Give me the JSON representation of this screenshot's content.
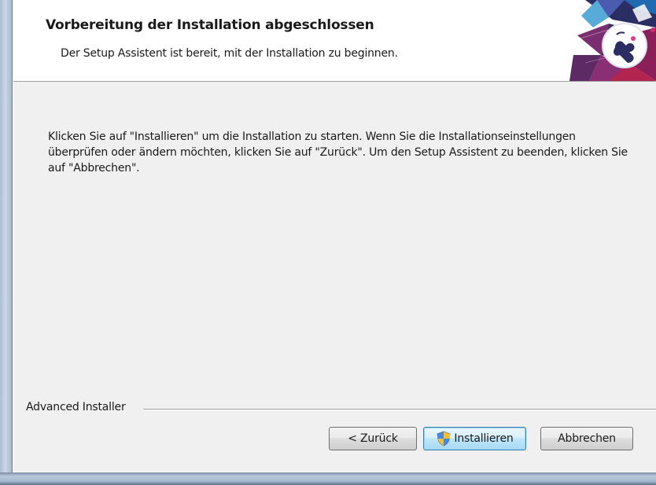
{
  "header": {
    "title": "Vorbereitung der Installation abgeschlossen",
    "subtitle": "Der Setup Assistent ist bereit, mit der Installation zu beginnen."
  },
  "body": {
    "text": "Klicken Sie auf \"Installieren\" um die Installation zu starten. Wenn Sie die Installationseinstellungen überprüfen oder ändern möchten, klicken Sie auf \"Zurück\". Um den Setup Assistent zu beenden, klicken Sie auf \"Abbrechen\"."
  },
  "footer": {
    "brand": "Advanced Installer",
    "buttons": {
      "back": "< Zurück",
      "install": "Installieren",
      "cancel": "Abbrechen"
    }
  },
  "icons": {
    "install_button_icon": "uac-shield-icon",
    "header_graphic": "setup-puzzle-graphic"
  },
  "colors": {
    "body_background": "#f0f0f0",
    "header_background": "#ffffff",
    "focused_button_border": "#3c7fb1"
  }
}
